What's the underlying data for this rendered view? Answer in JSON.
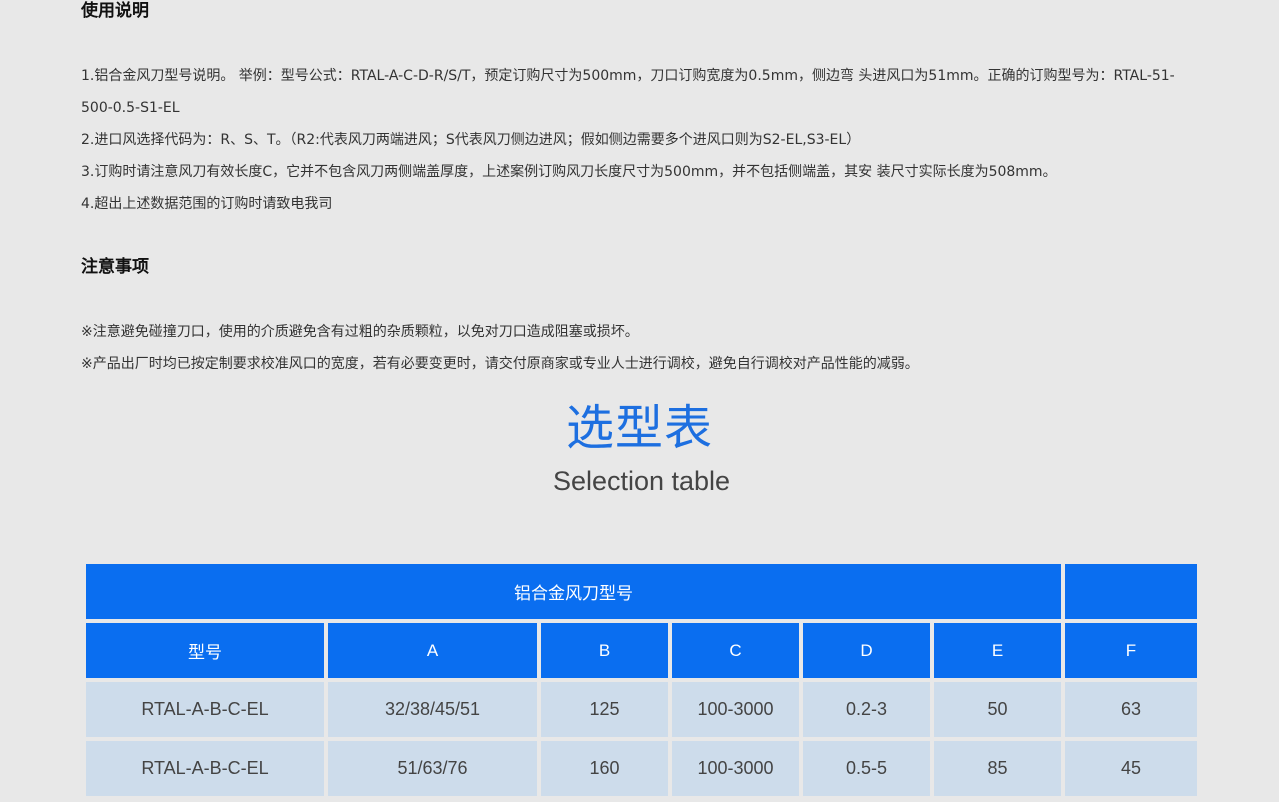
{
  "usage": {
    "heading": "使用说明",
    "lines": [
      "1.铝合金风刀型号说明。       举例：型号公式：RTAL-A-C-D-R/S/T，预定订购尺寸为500mm，刀口订购宽度为0.5mm，侧边弯 头进风口为51mm。正确的订购型号为：RTAL-51-500-0.5-S1-EL",
      "2.进口风选择代码为：R、S、T。（R2:代表风刀两端进风；S代表风刀侧边进风；假如侧边需要多个进风口则为S2-EL,S3-EL）",
      "3.订购时请注意风刀有效长度C，它并不包含风刀两侧端盖厚度，上述案例订购风刀长度尺寸为500mm，并不包括侧端盖，其安 装尺寸实际长度为508mm。",
      "4.超出上述数据范围的订购时请致电我司"
    ]
  },
  "notes": {
    "heading": "注意事项",
    "lines": [
      "※注意避免碰撞刀口，使用的介质避免含有过粗的杂质颗粒，以免对刀口造成阻塞或损坏。",
      "※产品出厂时均已按定制要求校准风口的宽度，若有必要变更时，请交付原商家或专业人士进行调校，避免自行调校对产品性能的减弱。"
    ]
  },
  "selection": {
    "title": "选型表",
    "subtitle": "Selection table"
  },
  "table": {
    "group_header": "铝合金风刀型号",
    "group_header_extra": "",
    "columns": [
      "型号",
      "A",
      "B",
      "C",
      "D",
      "E",
      "F"
    ],
    "rows": [
      [
        "RTAL-A-B-C-EL",
        "32/38/45/51",
        "125",
        "100-3000",
        "0.2-3",
        "50",
        "63"
      ],
      [
        "RTAL-A-B-C-EL",
        "51/63/76",
        "160",
        "100-3000",
        "0.5-5",
        "85",
        "45"
      ]
    ]
  },
  "colors": {
    "accent": "#0a6ef0",
    "title_blue": "#1d6fe0",
    "cell_bg": "#cddceb",
    "page_bg": "#e8e8e8"
  }
}
